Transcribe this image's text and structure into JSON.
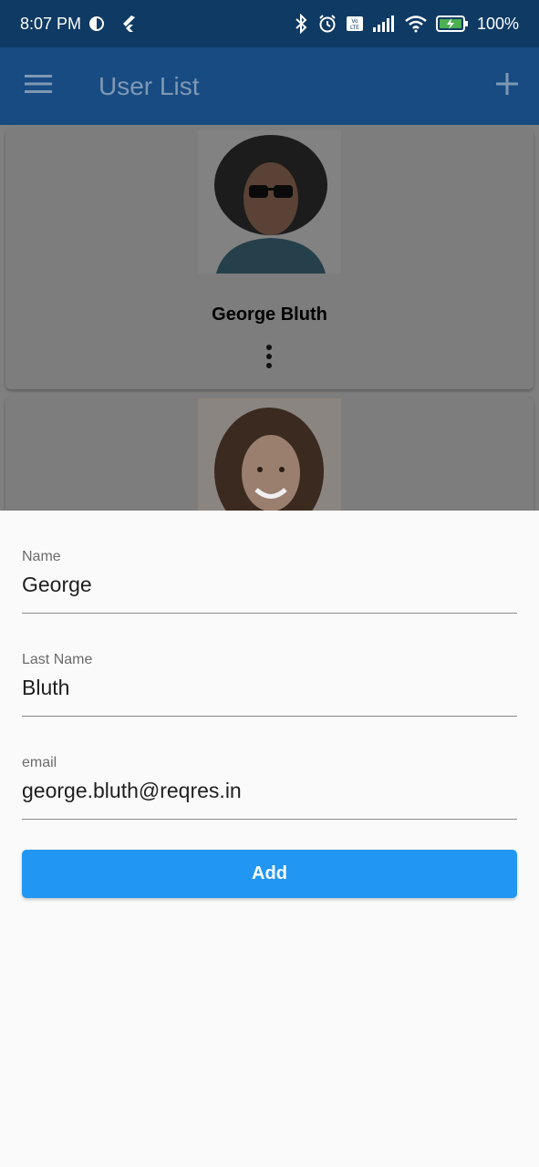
{
  "status_bar": {
    "time": "8:07 PM",
    "battery_percent": "100%",
    "icons": [
      "notification-icon",
      "flutter-icon",
      "bluetooth-icon",
      "alarm-icon",
      "volte-icon",
      "signal-icon",
      "wifi-icon",
      "battery-icon"
    ]
  },
  "app_bar": {
    "title": "User List",
    "menu_icon": "menu-icon",
    "add_icon": "plus-icon",
    "background": "#174b82"
  },
  "users": [
    {
      "name": "George Bluth",
      "avatar": "avatar-man-sunglasses",
      "more_icon": "more-vert-icon"
    },
    {
      "name": "",
      "avatar": "avatar-woman-smiling"
    }
  ],
  "form": {
    "fields": [
      {
        "label": "Name",
        "value": "George"
      },
      {
        "label": "Last Name",
        "value": "Bluth"
      },
      {
        "label": "email",
        "value": "george.bluth@reqres.in"
      }
    ],
    "submit_label": "Add",
    "submit_color": "#2196f3"
  }
}
